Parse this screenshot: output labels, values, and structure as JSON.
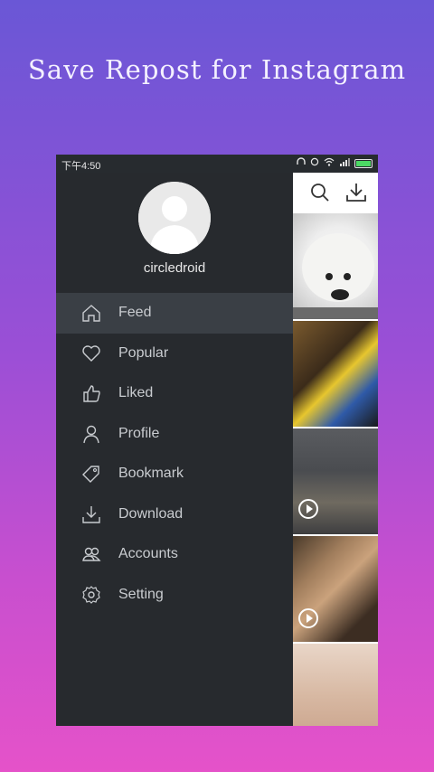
{
  "headline": "Save Repost for Instagram",
  "status_bar": {
    "time": "下午4:50"
  },
  "profile": {
    "username": "circledroid"
  },
  "menu": [
    {
      "label": "Feed",
      "icon": "home-icon",
      "active": true
    },
    {
      "label": "Popular",
      "icon": "heart-icon",
      "active": false
    },
    {
      "label": "Liked",
      "icon": "thumbs-up-icon",
      "active": false
    },
    {
      "label": "Profile",
      "icon": "person-icon",
      "active": false
    },
    {
      "label": "Bookmark",
      "icon": "tag-icon",
      "active": false
    },
    {
      "label": "Download",
      "icon": "download-icon",
      "active": false
    },
    {
      "label": "Accounts",
      "icon": "accounts-icon",
      "active": false
    },
    {
      "label": "Setting",
      "icon": "gear-icon",
      "active": false
    }
  ],
  "toolbar": {
    "search_icon": "search-icon",
    "download_icon": "download-icon"
  },
  "colors": {
    "drawer_bg": "#272a2e",
    "active_item_bg": "#3a3f45",
    "text": "#c9ccd0"
  }
}
